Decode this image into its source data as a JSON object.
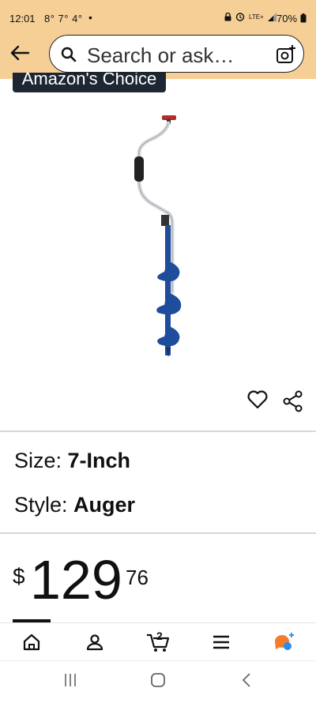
{
  "status_bar": {
    "time": "12:01",
    "weather": "8° 7° 4°",
    "dot": "•",
    "network": "LTE+",
    "battery": "70%"
  },
  "header": {
    "search_placeholder": "Search or ask…"
  },
  "product": {
    "badge": "Amazon's Choice",
    "size_label": "Size: ",
    "size_value": "7-Inch",
    "style_label": "Style: ",
    "style_value": "Auger",
    "price_symbol": "$",
    "price_whole": "129",
    "price_fraction": "76"
  },
  "tab_bar": {
    "tabs": [
      "home-icon",
      "account-icon",
      "cart-icon",
      "menu-icon",
      "rufus-icon"
    ],
    "cart_count": "2"
  },
  "colors": {
    "header_bg": "#f6cf97",
    "badge_bg": "#1d2733",
    "auger_blue": "#1f4d9c",
    "rufus_orange": "#f57c2b",
    "rufus_blue": "#2a8cf0"
  }
}
